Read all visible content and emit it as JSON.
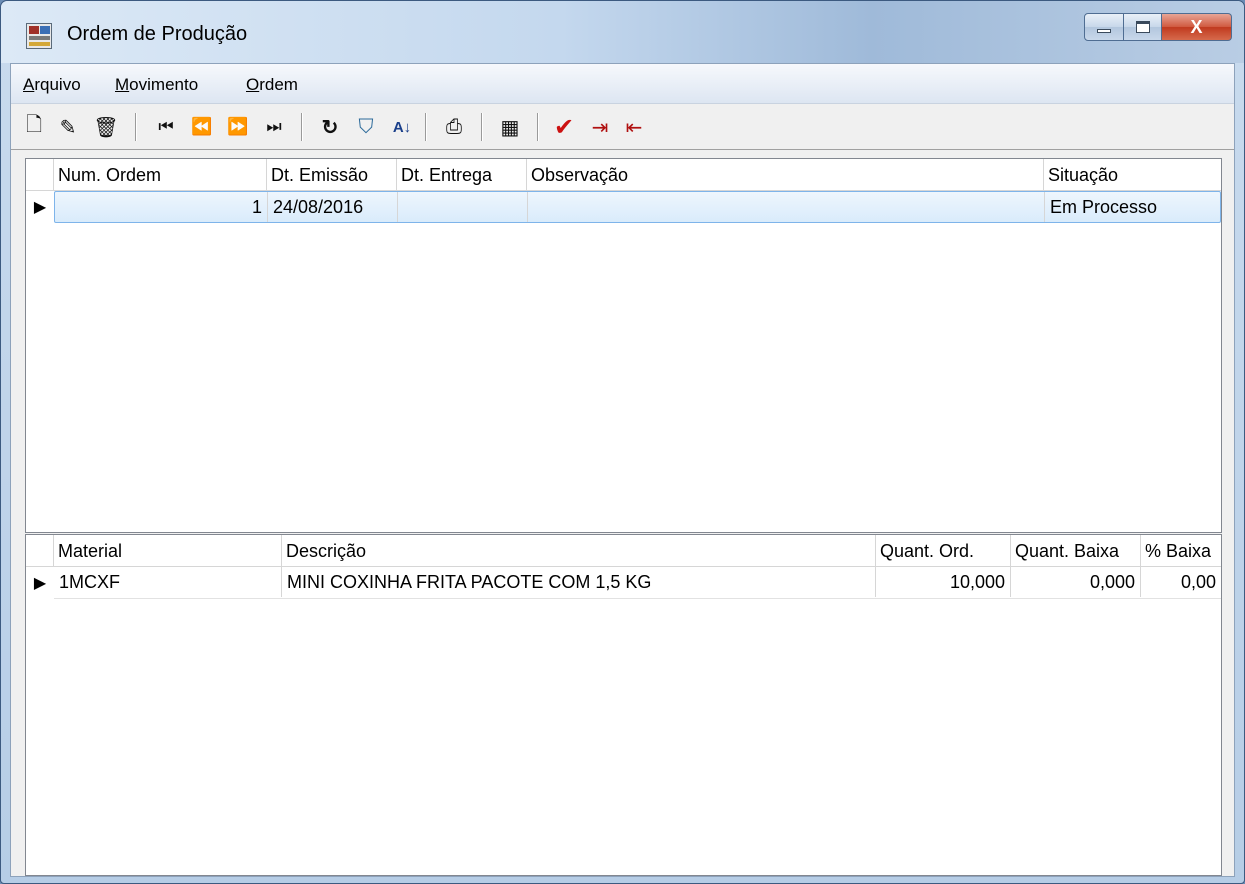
{
  "window": {
    "title": "Ordem de Produção",
    "close_glyph": "X"
  },
  "menu": [
    {
      "first": "A",
      "rest": "rquivo"
    },
    {
      "first": "M",
      "rest": "ovimento"
    },
    {
      "first": "O",
      "rest": "rdem"
    }
  ],
  "toolbar": {
    "buttons": [
      "new-icon",
      "edit-icon",
      "delete-icon",
      "first-record-icon",
      "prev-record-icon",
      "next-record-icon",
      "last-record-icon",
      "refresh-icon",
      "filter-icon",
      "sort-az-icon",
      "print-icon",
      "properties-icon",
      "confirm-icon",
      "import-icon",
      "export-icon"
    ],
    "glyphs": {
      "new": "🗋",
      "edit": "✎",
      "delete": "🗑",
      "first": "⏮",
      "prev": "⏪",
      "next": "⏩",
      "last": "⏭",
      "refresh": "↻",
      "filter": "⛉",
      "sort": "A↓",
      "print": "⎙",
      "properties": "▦",
      "confirm": "✔",
      "import": "⇥",
      "export": "⇤"
    }
  },
  "orders": {
    "columns": [
      "Num. Ordem",
      "Dt. Emissão",
      "Dt. Entrega",
      "Observação",
      "Situação"
    ],
    "rows": [
      {
        "num": "1",
        "emissao": "24/08/2016",
        "entrega": "",
        "obs": "",
        "situacao": "Em Processo"
      }
    ]
  },
  "materials": {
    "columns": [
      "Material",
      "Descrição",
      "Quant. Ord.",
      "Quant. Baixa",
      "% Baixa"
    ],
    "rows": [
      {
        "material": "1MCXF",
        "descricao": "MINI COXINHA FRITA PACOTE COM 1,5 KG",
        "quant_ord": "10,000",
        "quant_baixa": "0,000",
        "pct_baixa": "0,00"
      }
    ]
  },
  "colors": {
    "selection_border": "#7eb4ea",
    "close_button": "#c03a1f",
    "confirm_icon": "#cc1111"
  }
}
